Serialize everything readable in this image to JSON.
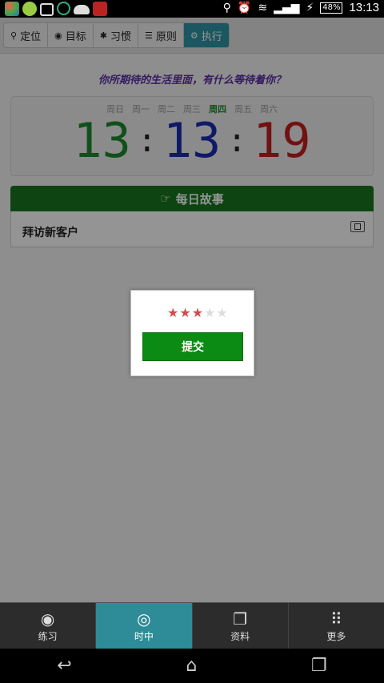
{
  "status_bar": {
    "time": "13:13",
    "battery": "48%",
    "left_icons": [
      "app-icon",
      "wechat-icon",
      "image-icon",
      "sync-icon",
      "weather-icon",
      "game-icon"
    ],
    "right_icons": [
      "location-icon",
      "alarm-icon",
      "wifi-icon",
      "signal-icon",
      "charging-icon"
    ]
  },
  "top_nav": {
    "items": [
      {
        "label": "定位",
        "icon": "location-icon"
      },
      {
        "label": "目标",
        "icon": "target-icon"
      },
      {
        "label": "习惯",
        "icon": "gear-icon"
      },
      {
        "label": "原则",
        "icon": "list-icon"
      },
      {
        "label": "执行",
        "icon": "execute-icon",
        "active": true
      }
    ]
  },
  "quote": "你所期待的生活里面，有什么等待着你？",
  "clock": {
    "weekdays": [
      "周日",
      "周一",
      "周二",
      "周三",
      "周四",
      "周五",
      "周六"
    ],
    "today_index": 4,
    "hours": "13",
    "minutes": "13",
    "seconds": "19",
    "colors": {
      "hours": "#1c8a2e",
      "minutes": "#1a2bb3",
      "seconds": "#c41e1e"
    }
  },
  "daily_story": {
    "title": "每日故事",
    "item": "拜访新客户"
  },
  "rating_dialog": {
    "rating": 3,
    "max": 5,
    "submit_label": "提交"
  },
  "bottom_tabs": {
    "items": [
      {
        "label": "练习",
        "icon": "eye-icon"
      },
      {
        "label": "时中",
        "icon": "target-icon",
        "active": true
      },
      {
        "label": "资料",
        "icon": "documents-icon"
      },
      {
        "label": "更多",
        "icon": "grid-icon"
      }
    ]
  },
  "colors": {
    "accent": "#2e96a6",
    "story_green": "#17751e",
    "submit_green": "#0b8a14"
  }
}
